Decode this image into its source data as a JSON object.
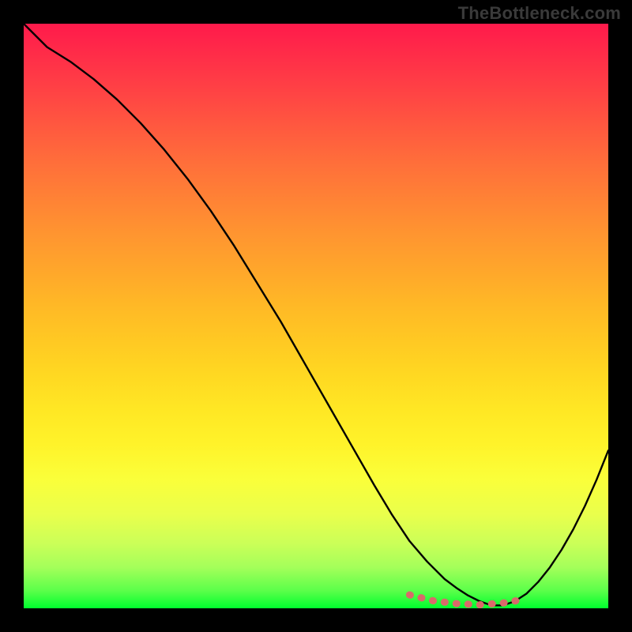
{
  "watermark": "TheBottleneck.com",
  "colors": {
    "curve_stroke": "#000000",
    "marker_stroke": "#d96a6a",
    "background_top": "#ff1a4b",
    "background_bottom": "#00ff2e",
    "frame": "#000000"
  },
  "chart_data": {
    "type": "line",
    "title": "",
    "xlabel": "",
    "ylabel": "",
    "xlim": [
      0,
      100
    ],
    "ylim": [
      0,
      100
    ],
    "grid": false,
    "legend": false,
    "series": [
      {
        "name": "bottleneck-curve",
        "x": [
          0,
          4,
          8,
          12,
          16,
          20,
          24,
          28,
          32,
          36,
          40,
          44,
          48,
          52,
          56,
          60,
          63,
          66,
          69,
          72,
          74,
          76,
          78,
          80,
          82,
          84,
          86,
          88,
          90,
          92,
          94,
          96,
          98,
          100
        ],
        "y": [
          100,
          96,
          93.5,
          90.5,
          87,
          83,
          78.5,
          73.5,
          68,
          62,
          55.5,
          49,
          42,
          35,
          28,
          21,
          16,
          11.5,
          8,
          5,
          3.5,
          2.2,
          1.2,
          0.5,
          0.5,
          1.2,
          2.5,
          4.5,
          7,
          10,
          13.5,
          17.5,
          22,
          27
        ]
      },
      {
        "name": "bottom-marker-band",
        "x": [
          66,
          70,
          74,
          78,
          82,
          86
        ],
        "y": [
          2.3,
          1.3,
          0.8,
          0.6,
          0.9,
          1.6
        ]
      }
    ],
    "marker_style": {
      "stroke_width_px": 9,
      "dash": "1 14"
    }
  }
}
